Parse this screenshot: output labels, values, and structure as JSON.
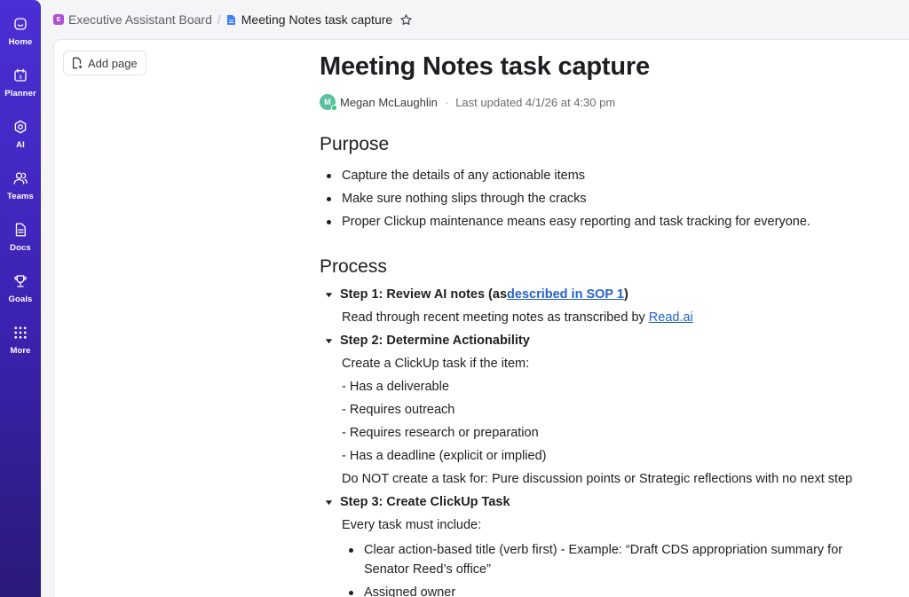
{
  "sidebar": {
    "items": [
      {
        "label": "Home",
        "icon": "home-icon"
      },
      {
        "label": "Planner",
        "icon": "calendar-icon"
      },
      {
        "label": "AI",
        "icon": "ai-icon"
      },
      {
        "label": "Teams",
        "icon": "teams-icon"
      },
      {
        "label": "Docs",
        "icon": "docs-icon"
      },
      {
        "label": "Goals",
        "icon": "trophy-icon"
      },
      {
        "label": "More",
        "icon": "grid-icon"
      }
    ],
    "planner_day": "9",
    "accent": "#4b2fd6"
  },
  "breadcrumb": {
    "board_badge": "E",
    "board": "Executive Assistant Board",
    "separator": "/",
    "current": "Meeting Notes task capture"
  },
  "sidebar_panel": {
    "add_page": "Add page"
  },
  "doc": {
    "title": "Meeting Notes task capture",
    "author_initial": "M",
    "author": "Megan McLaughlin",
    "meta_sep": "·",
    "updated": "Last updated 4/1/26 at 4:30 pm",
    "purpose_heading": "Purpose",
    "purpose_items": [
      "Capture the details of any actionable items",
      "Make sure nothing slips through the cracks",
      "Proper Clickup maintenance means easy reporting and task tracking for everyone."
    ],
    "process_heading": "Process",
    "step1": {
      "prefix": "Step 1: Review AI notes (as ",
      "link": "described in SOP 1",
      "suffix": ")",
      "body_prefix": "Read through recent meeting notes as transcribed by ",
      "body_link": "Read.ai"
    },
    "step2": {
      "heading": "Step 2: Determine Actionability",
      "lines": [
        "Create a ClickUp task if the item:",
        "- Has a deliverable",
        "- Requires outreach",
        "- Requires research or preparation",
        "- Has a deadline (explicit or implied)",
        "Do NOT create a task for: Pure discussion points or Strategic reflections with no next step"
      ]
    },
    "step3": {
      "heading": "Step 3: Create ClickUp Task",
      "intro": "Every task must include:",
      "items": [
        "Clear action-based title (verb first) - Example: “Draft CDS appropriation summary for Senator Reed’s office”",
        "Assigned owner"
      ]
    }
  }
}
